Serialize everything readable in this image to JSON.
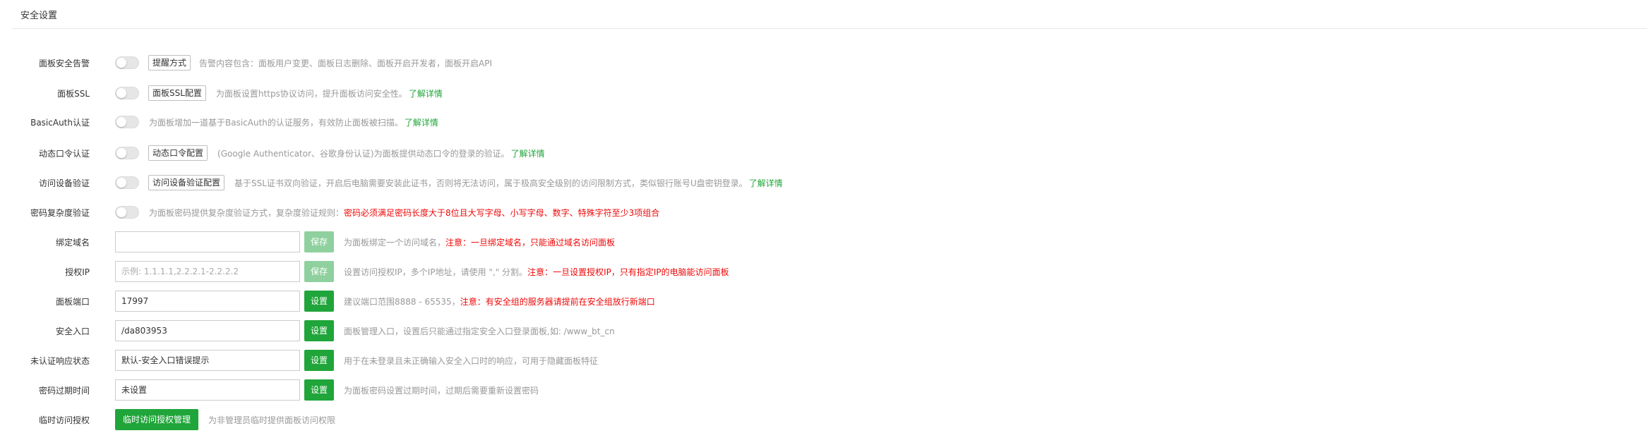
{
  "section": {
    "title": "安全设置"
  },
  "rows": {
    "alarm": {
      "label": "面板安全告警",
      "button": "提醒方式",
      "desc": "告警内容包含：面板用户变更、面板日志删除、面板开启开发者，面板开启API"
    },
    "ssl": {
      "label": "面板SSL",
      "button": "面板SSL配置",
      "desc": "为面板设置https协议访问，提升面板访问安全性。",
      "link": "了解详情"
    },
    "basicauth": {
      "label": "BasicAuth认证",
      "desc": "为面板增加一道基于BasicAuth的认证服务，有效防止面板被扫描。",
      "link": "了解详情"
    },
    "totp": {
      "label": "动态口令认证",
      "button": "动态口令配置",
      "desc": "(Google Authenticator、谷歌身份认证)为面板提供动态口令的登录的验证。",
      "link": "了解详情"
    },
    "device": {
      "label": "访问设备验证",
      "button": "访问设备验证配置",
      "desc": "基于SSL证书双向验证，开启后电脑需要安装此证书，否则将无法访问，属于极高安全级别的访问限制方式，类似银行账号U盘密钥登录。",
      "link": "了解详情"
    },
    "password_complexity": {
      "label": "密码复杂度验证",
      "desc": "为面板密码提供复杂度验证方式，复杂度验证规则：",
      "warn": "密码必须满足密码长度大于8位且大写字母、小写字母、数字、特殊字符至少3项组合"
    },
    "domain": {
      "label": "绑定域名",
      "value": "",
      "button": "保存",
      "desc": "为面板绑定一个访问域名，",
      "warn": "注意：一旦绑定域名，只能通过域名访问面板"
    },
    "auth_ip": {
      "label": "授权IP",
      "placeholder": "示例: 1.1.1.1,2.2.2.1-2.2.2.2",
      "button": "保存",
      "desc": "设置访问授权IP，多个IP地址，请使用 \",\" 分割。",
      "warn": "注意：一旦设置授权IP，只有指定IP的电脑能访问面板"
    },
    "port": {
      "label": "面板端口",
      "value": "17997",
      "button": "设置",
      "desc": "建议端口范围8888 - 65535，",
      "warn": "注意：有安全组的服务器请提前在安全组放行新端口"
    },
    "entrance": {
      "label": "安全入口",
      "value": "/da803953",
      "button": "设置",
      "desc": "面板管理入口，设置后只能通过指定安全入口登录面板,如: /www_bt_cn"
    },
    "unauth_status": {
      "label": "未认证响应状态",
      "value": "默认-安全入口错误提示",
      "button": "设置",
      "desc": "用于在未登录且未正确输入安全入口时的响应，可用于隐藏面板特征"
    },
    "expire": {
      "label": "密码过期时间",
      "value": "未设置",
      "button": "设置",
      "desc": "为面板密码设置过期时间，过期后需要重新设置密码"
    },
    "temp_access": {
      "label": "临时访问授权",
      "button": "临时访问授权管理",
      "desc": "为非管理员临时提供面板访问权限"
    }
  },
  "colors": {
    "accent": "#20a53a",
    "warning": "#ef0808",
    "muted": "#999999"
  }
}
